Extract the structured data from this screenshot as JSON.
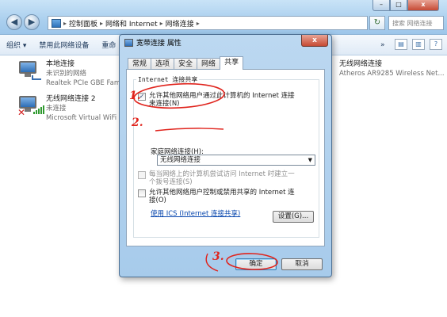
{
  "explorer": {
    "breadcrumbs": [
      "控制面板",
      "网络和 Internet",
      "网络连接"
    ],
    "search_placeholder": "搜索 网络连接",
    "caption": {
      "min": "–",
      "max": "□",
      "close": "x"
    },
    "toolbar": {
      "organize": "组织 ▾",
      "disable": "禁用此网络设备",
      "rename": "重命",
      "more": "»"
    },
    "connections": [
      {
        "name": "本地连接",
        "status": "未识别的网络",
        "device": "Realtek PCIe GBE Famil"
      },
      {
        "name": "无线网络连接 2",
        "status": "未连接",
        "device": "Microsoft Virtual WiFi M"
      },
      {
        "name": "无线网络连接",
        "status": "",
        "device": "Atheros AR9285 Wireless Net..."
      }
    ]
  },
  "dialog": {
    "title": "宽带连接 属性",
    "close": "x",
    "tabs": [
      "常规",
      "选项",
      "安全",
      "网络",
      "共享"
    ],
    "active_tab": "共享",
    "group_title": "Internet 连接共享",
    "allow_share_line1": "允许其他网络用户通过此计算机的 Internet 连接",
    "allow_share_line2": "来连接(N)",
    "home_network_label": "家庭网络连接(H):",
    "home_network_value": "无线网络连接",
    "dial_line1": "每当网络上的计算机尝试访问 Internet 时建立一",
    "dial_line2": "个拨号连接(S)",
    "control_line1": "允许其他网络用户控制或禁用共享的 Internet 连",
    "control_line2": "接(O)",
    "ics_link": "使用 ICS (Internet 连接共享)",
    "settings_button": "设置(G)...",
    "ok_button": "确定",
    "cancel_button": "取消"
  },
  "annotations": {
    "step1": "1.",
    "step2": "2.",
    "step3": "3.",
    "color": "#e0241d"
  }
}
